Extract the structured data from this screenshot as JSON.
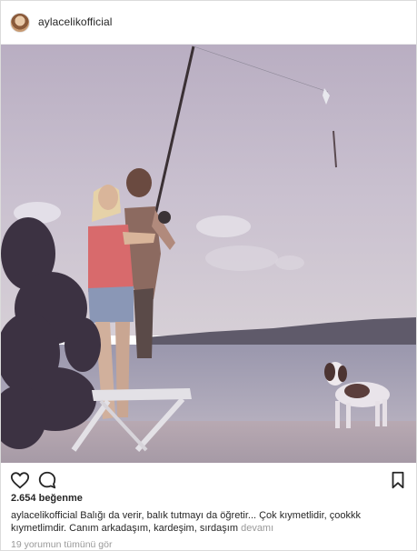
{
  "header": {
    "username": "aylacelikofficial"
  },
  "post": {
    "image_alt": "",
    "likes_count": "2.654",
    "likes_label": "beğenme",
    "caption_user": "aylacelikofficial",
    "caption_text": "Balığı da verir, balık tutmayı da öğretir... Çok kıymetlidir, çookkk kıymetlimdir. Canım arkadaşım, kardeşim, sırdaşım",
    "more_label": "devamı",
    "view_comments": "19 yorumun tümünü gör"
  },
  "icons": {
    "like": "heart-icon",
    "comment": "comment-icon",
    "save": "bookmark-icon"
  },
  "colors": {
    "text": "#262626",
    "muted": "#999999",
    "border": "#dbdbdb"
  }
}
